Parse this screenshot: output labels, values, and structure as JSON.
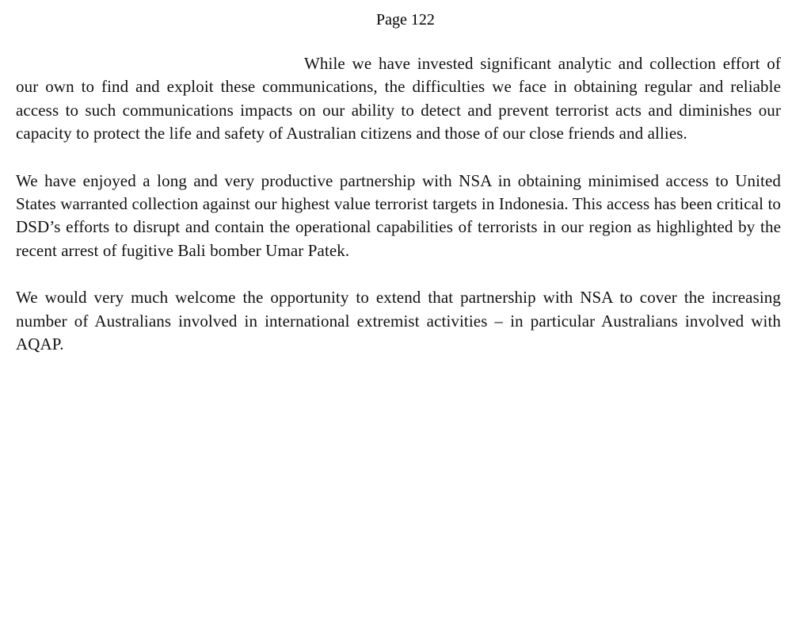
{
  "header": {
    "page_label": "Page 122"
  },
  "body": {
    "paragraphs": [
      "While we have invested significant analytic and collection effort of our own to find and exploit these communications, the difficulties we face in obtaining regular and reliable access to such communications impacts on our ability to detect and prevent terrorist acts and diminishes our capacity to protect the life and safety of Australian citizens and those of our close friends and allies.",
      "We have enjoyed a long and very productive partnership with NSA in obtaining minimised access to United States warranted collection against our highest value terrorist targets in Indonesia. This access has been critical to DSD’s efforts to disrupt and contain the operational capabilities of terrorists in our region as highlighted by the recent arrest of fugitive Bali bomber Umar Patek.",
      "We would very much welcome the opportunity to extend that partnership with NSA to cover the increasing number of Australians involved in international extremist activities – in particular Australians involved with AQAP."
    ]
  }
}
